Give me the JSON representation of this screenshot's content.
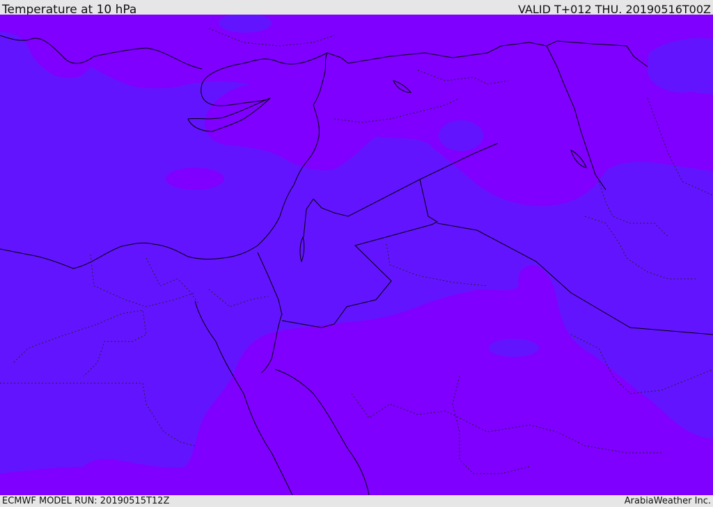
{
  "header": {
    "title": "Temperature at 10 hPa",
    "valid": "VALID T+012 THU. 20190516T00Z"
  },
  "footer": {
    "model_run": "ECMWF MODEL RUN: 20190515T12Z",
    "credit": "ArabiaWeather Inc."
  },
  "map": {
    "fill_colors": {
      "warmer_band": "#7f00ff",
      "cooler_band": "#6314ff"
    },
    "line_colors": {
      "coastline": "#000000",
      "border": "#000000"
    }
  }
}
